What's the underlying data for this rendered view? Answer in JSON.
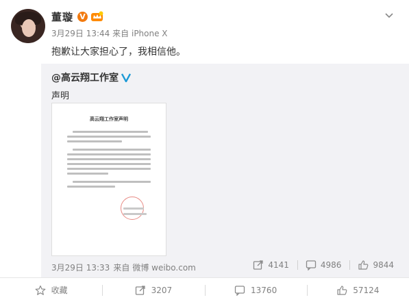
{
  "post": {
    "author": "董璇",
    "timestamp": "3月29日 13:44",
    "via_prefix": "来自",
    "device": "iPhone X",
    "text": "抱歉让大家担心了，我相信他。",
    "verified_badge": "V"
  },
  "repost": {
    "mention": "@高云翔工作室",
    "text": "声明",
    "document_title": "高云翔工作室声明",
    "timestamp": "3月29日 13:33",
    "via_prefix": "来自",
    "source": "微博 weibo.com",
    "stats": {
      "reposts": "4141",
      "comments": "4986",
      "likes": "9844"
    }
  },
  "actions": {
    "favorite_label": "收藏",
    "repost_count": "3207",
    "comment_count": "13760",
    "like_count": "57124"
  },
  "icons": {
    "menu": "chevron-down-icon",
    "favorite": "star-icon",
    "repost": "repost-icon",
    "comment": "comment-icon",
    "like": "thumbs-up-icon"
  },
  "colors": {
    "accent_orange": "#f27a0f",
    "verified_blue": "#1d9ad6",
    "muted_text": "#808080",
    "repost_bg": "#f2f2f5"
  }
}
